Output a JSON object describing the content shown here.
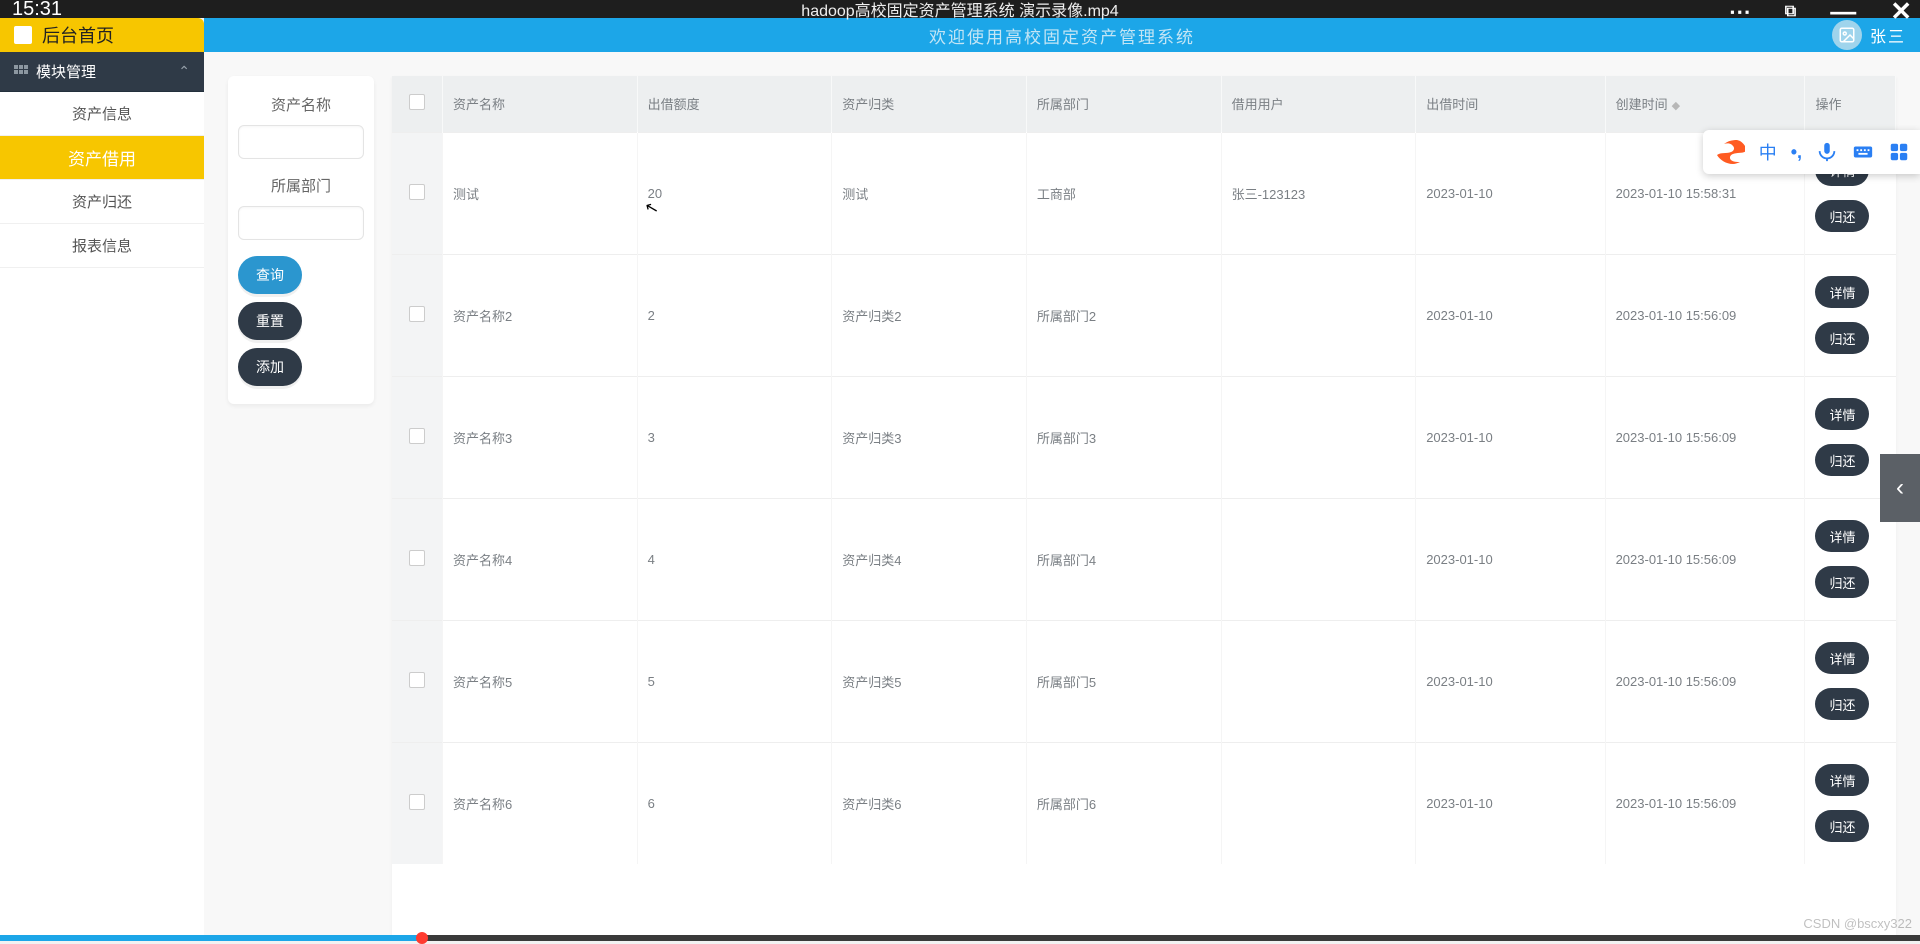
{
  "player": {
    "time": "15:31",
    "title": "hadoop高校固定资产管理系统 演示录像.mp4"
  },
  "banner": {
    "welcome": "欢迎使用高校固定资产管理系统",
    "user_name": "张三"
  },
  "home_tab": "后台首页",
  "sidebar": {
    "group": "模块管理",
    "items": [
      {
        "label": "资产信息"
      },
      {
        "label": "资产借用"
      },
      {
        "label": "资产归还"
      },
      {
        "label": "报表信息"
      }
    ],
    "active_index": 1
  },
  "search": {
    "field1_label": "资产名称",
    "field2_label": "所属部门",
    "btn_query": "查询",
    "btn_reset": "重置",
    "btn_add": "添加"
  },
  "table": {
    "headers": [
      "",
      "资产名称",
      "出借额度",
      "资产归类",
      "所属部门",
      "借用用户",
      "出借时间",
      "创建时间",
      "操作"
    ],
    "rows": [
      {
        "name": "测试",
        "amount": "20",
        "cat": "测试",
        "dept": "工商部",
        "user": "张三-123123",
        "lend": "2023-01-10",
        "created": "2023-01-10 15:58:31"
      },
      {
        "name": "资产名称2",
        "amount": "2",
        "cat": "资产归类2",
        "dept": "所属部门2",
        "user": "",
        "lend": "2023-01-10",
        "created": "2023-01-10 15:56:09"
      },
      {
        "name": "资产名称3",
        "amount": "3",
        "cat": "资产归类3",
        "dept": "所属部门3",
        "user": "",
        "lend": "2023-01-10",
        "created": "2023-01-10 15:56:09"
      },
      {
        "name": "资产名称4",
        "amount": "4",
        "cat": "资产归类4",
        "dept": "所属部门4",
        "user": "",
        "lend": "2023-01-10",
        "created": "2023-01-10 15:56:09"
      },
      {
        "name": "资产名称5",
        "amount": "5",
        "cat": "资产归类5",
        "dept": "所属部门5",
        "user": "",
        "lend": "2023-01-10",
        "created": "2023-01-10 15:56:09"
      },
      {
        "name": "资产名称6",
        "amount": "6",
        "cat": "资产归类6",
        "dept": "所属部门6",
        "user": "",
        "lend": "2023-01-10",
        "created": "2023-01-10 15:56:09"
      }
    ],
    "action_detail": "详情",
    "action_return": "归还"
  },
  "ime": {
    "lang": "中"
  },
  "watermark": "CSDN @bscxy322"
}
